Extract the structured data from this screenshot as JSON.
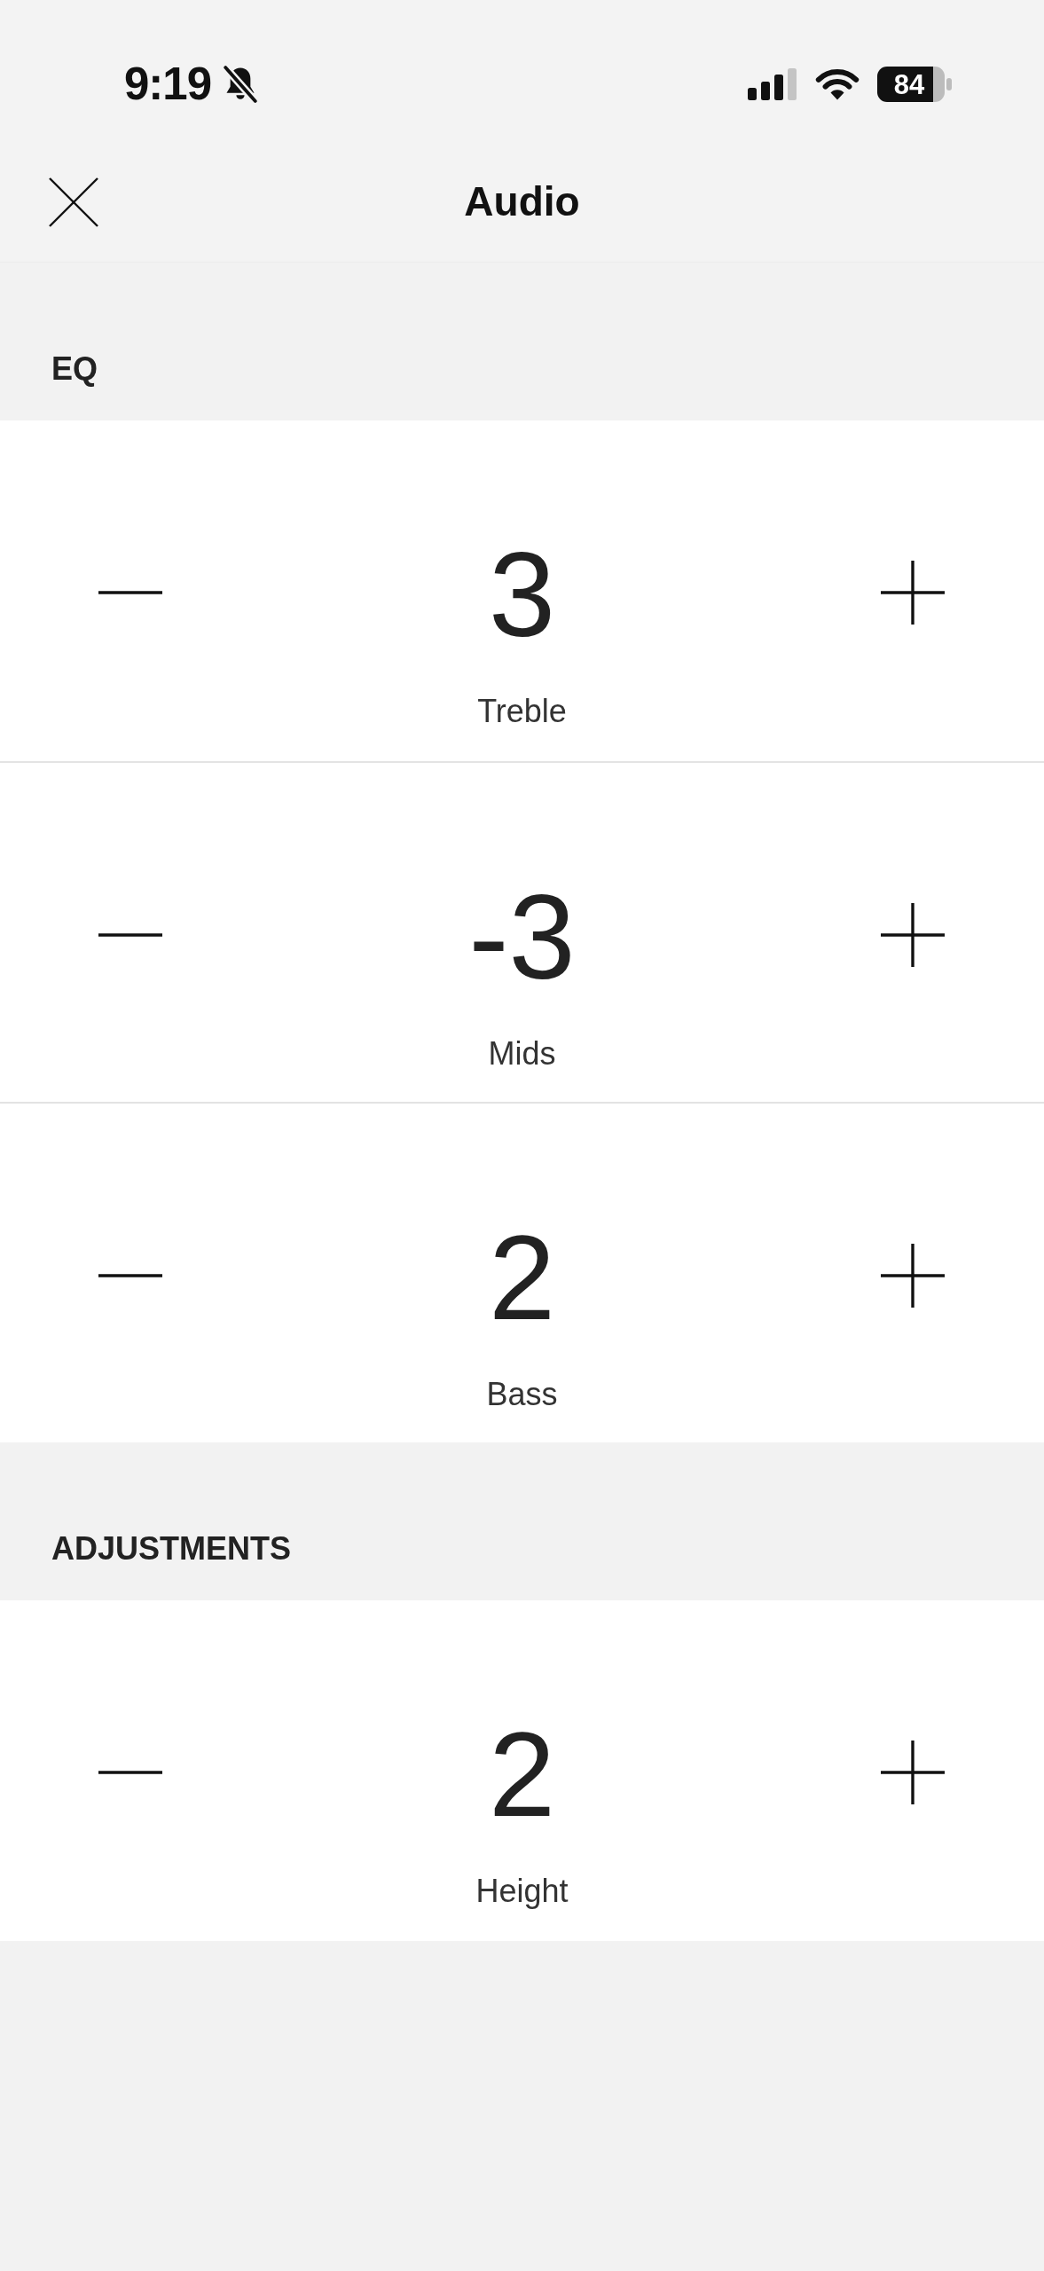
{
  "status_bar": {
    "time": "9:19",
    "battery": "84"
  },
  "header": {
    "title": "Audio"
  },
  "sections": [
    {
      "title": "EQ",
      "rows": [
        {
          "value": "3",
          "label": "Treble"
        },
        {
          "value": "-3",
          "label": "Mids"
        },
        {
          "value": "2",
          "label": "Bass"
        }
      ]
    },
    {
      "title": "ADJUSTMENTS",
      "rows": [
        {
          "value": "2",
          "label": "Height"
        }
      ]
    }
  ]
}
